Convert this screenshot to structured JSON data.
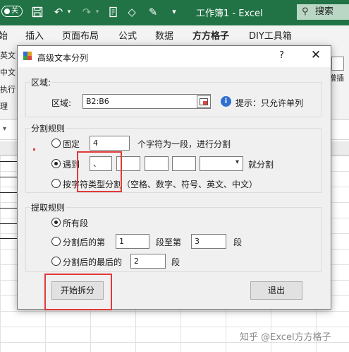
{
  "excel": {
    "autosave_toggle": "关",
    "window_title": "工作簿1 - Excel",
    "search_label": "搜索",
    "tabs": [
      "始",
      "插入",
      "页面布局",
      "公式",
      "数据",
      "方方格子",
      "DIY工具箱"
    ],
    "active_tab": "方方格子",
    "ribbon_left_labels": [
      "英文",
      "中文",
      "执行",
      "理"
    ],
    "ribbon_right_label": "增插",
    "watermark": "知乎 @Excel方方格子"
  },
  "dialog": {
    "title": "高级文本分列",
    "help": "?",
    "close": "✕",
    "region": {
      "group_title": "区域:",
      "label": "区域:",
      "value": "B2:B6",
      "hint": "提示：只允许单列"
    },
    "split": {
      "group_title": "分割规则",
      "fixed_label": "固定",
      "fixed_value": "4",
      "fixed_suffix": "个字符为一段，进行分割",
      "meet_label": "遇到",
      "meet_values": [
        "、",
        "",
        "",
        ""
      ],
      "meet_suffix": "就分割",
      "bytype_label": "按字符类型分割（空格、数字、符号、英文、中文）",
      "selected": "meet"
    },
    "extract": {
      "group_title": "提取规则",
      "all_label": "所有段",
      "after_label": "分割后的第",
      "after_from": "1",
      "after_mid": "段至第",
      "after_to": "3",
      "after_suffix": "段",
      "last_label": "分割后的最后的",
      "last_value": "2",
      "last_suffix": "段",
      "selected": "all"
    },
    "start_button": "开始拆分",
    "exit_button": "退出"
  },
  "colors": {
    "excel_green": "#217346",
    "highlight_red": "#e03a3a"
  }
}
